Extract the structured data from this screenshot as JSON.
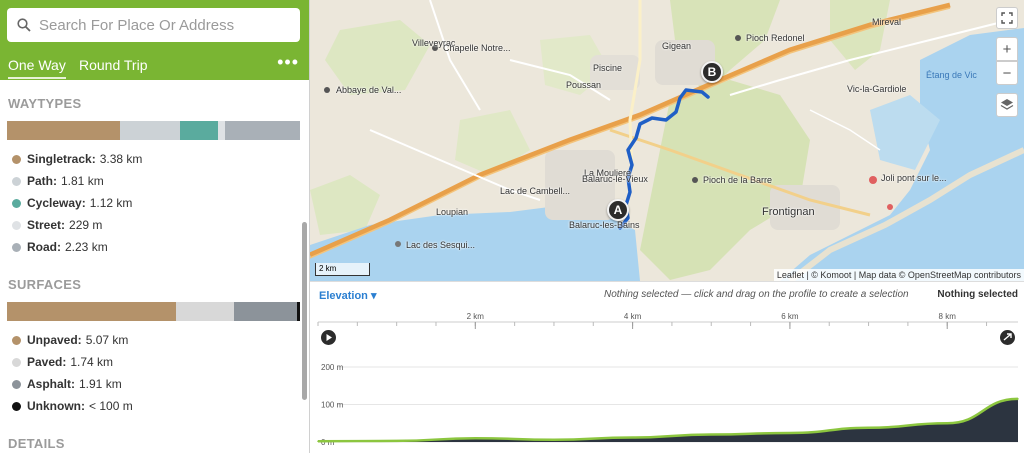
{
  "search": {
    "placeholder": "Search For Place Or Address"
  },
  "tabs": {
    "one_way": "One Way",
    "round_trip": "Round Trip",
    "more": "•••"
  },
  "waytypes": {
    "title": "WAYTYPES",
    "items": [
      {
        "name": "Singletrack:",
        "value": "3.38 km",
        "color": "#b4926a",
        "km": 3.38
      },
      {
        "name": "Path:",
        "value": "1.81 km",
        "color": "#ccd2d6",
        "km": 1.81
      },
      {
        "name": "Cycleway:",
        "value": "1.12 km",
        "color": "#5aab9e",
        "km": 1.12
      },
      {
        "name": "Street:",
        "value": "229 m",
        "color": "#dfe2e5",
        "km": 0.229
      },
      {
        "name": "Road:",
        "value": "2.23 km",
        "color": "#a9b0b7",
        "km": 2.23
      }
    ]
  },
  "surfaces": {
    "title": "SURFACES",
    "items": [
      {
        "name": "Unpaved:",
        "value": "5.07 km",
        "color": "#b4926a",
        "km": 5.07
      },
      {
        "name": "Paved:",
        "value": "1.74 km",
        "color": "#d8d8d8",
        "km": 1.74
      },
      {
        "name": "Asphalt:",
        "value": "1.91 km",
        "color": "#8c939a",
        "km": 1.91
      },
      {
        "name": "Unknown:",
        "value": "< 100 m",
        "color": "#111111",
        "km": 0.08
      }
    ]
  },
  "details": {
    "title": "DETAILS"
  },
  "map": {
    "places": [
      {
        "name": "Villeveyrac"
      },
      {
        "name": "Chapelle Notre..."
      },
      {
        "name": "Gigean"
      },
      {
        "name": "Pioch Redonel"
      },
      {
        "name": "Mireval"
      },
      {
        "name": "Piscine"
      },
      {
        "name": "Poussan"
      },
      {
        "name": "Abbaye de Val..."
      },
      {
        "name": "Vic-la-Gardiole"
      },
      {
        "name": "Étang de Vic"
      },
      {
        "name": "La Mouliere"
      },
      {
        "name": "Balaruc-le-Vieux"
      },
      {
        "name": "Lac de Cambell..."
      },
      {
        "name": "Pioch de la Barre"
      },
      {
        "name": "Joli pont sur le..."
      },
      {
        "name": "Loupian"
      },
      {
        "name": "Frontignan"
      },
      {
        "name": "Balaruc-les-Bains"
      },
      {
        "name": "Lac des Sesqui..."
      }
    ],
    "marker_start": "A",
    "marker_end": "B",
    "scale": "2 km",
    "attribution": "Leaflet | © Komoot | Map data © OpenStreetMap contributors",
    "zoom_in": "+",
    "zoom_out": "−"
  },
  "elevation": {
    "dropdown": "Elevation",
    "hint": "Nothing selected — click and drag on the profile to create a selection",
    "selection": "Nothing selected",
    "x_ticks": [
      "2 km",
      "4 km",
      "6 km",
      "8 km"
    ],
    "y_ticks": [
      "200 m",
      "100 m",
      "0 m"
    ]
  },
  "chart_data": {
    "type": "area",
    "x": [
      0,
      1,
      2,
      3,
      4,
      5,
      6,
      7,
      8,
      8.9
    ],
    "y": [
      2,
      3,
      10,
      6,
      12,
      20,
      24,
      38,
      50,
      115
    ],
    "x_ticks": [
      2,
      4,
      6,
      8
    ],
    "y_ticks": [
      0,
      100,
      200
    ],
    "ylim": [
      0,
      220
    ],
    "series": [
      {
        "values": [
          2,
          3,
          10,
          6,
          12,
          20,
          24,
          38,
          50,
          115
        ]
      }
    ]
  }
}
